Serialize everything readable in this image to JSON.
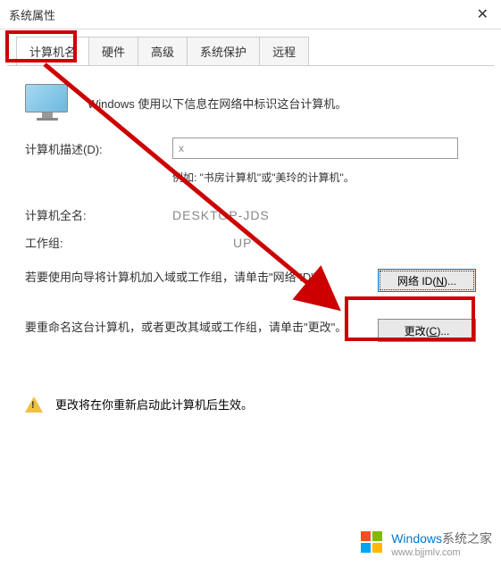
{
  "window": {
    "title": "系统属性",
    "close_symbol": "✕"
  },
  "tabs": {
    "items": [
      {
        "label": "计算机名",
        "active": true
      },
      {
        "label": "硬件",
        "active": false
      },
      {
        "label": "高级",
        "active": false
      },
      {
        "label": "系统保护",
        "active": false
      },
      {
        "label": "远程",
        "active": false
      }
    ]
  },
  "intro": {
    "text": "Windows 使用以下信息在网络中标识这台计算机。"
  },
  "description": {
    "label": "计算机描述(D):",
    "value": "x",
    "example": "例如: \"书房计算机\"或\"美玲的计算机\"。"
  },
  "fullname": {
    "label": "计算机全名:",
    "value": "DESKTOP-JDS"
  },
  "workgroup": {
    "label": "工作组:",
    "value": "UP"
  },
  "network_id": {
    "text": "若要使用向导将计算机加入域或工作组，请单击\"网络 ID\"。",
    "button_prefix": "网络 ID(",
    "button_letter": "N",
    "button_suffix": ")..."
  },
  "change": {
    "text": "要重命名这台计算机，或者更改其域或工作组，请单击\"更改\"。",
    "button_prefix": "更改(",
    "button_letter": "C",
    "button_suffix": ")..."
  },
  "restart": {
    "text": "更改将在你重新启动此计算机后生效。"
  },
  "watermark": {
    "brand": "Windows",
    "sub": "系统之家",
    "url": "www.bjjmlv.com"
  }
}
